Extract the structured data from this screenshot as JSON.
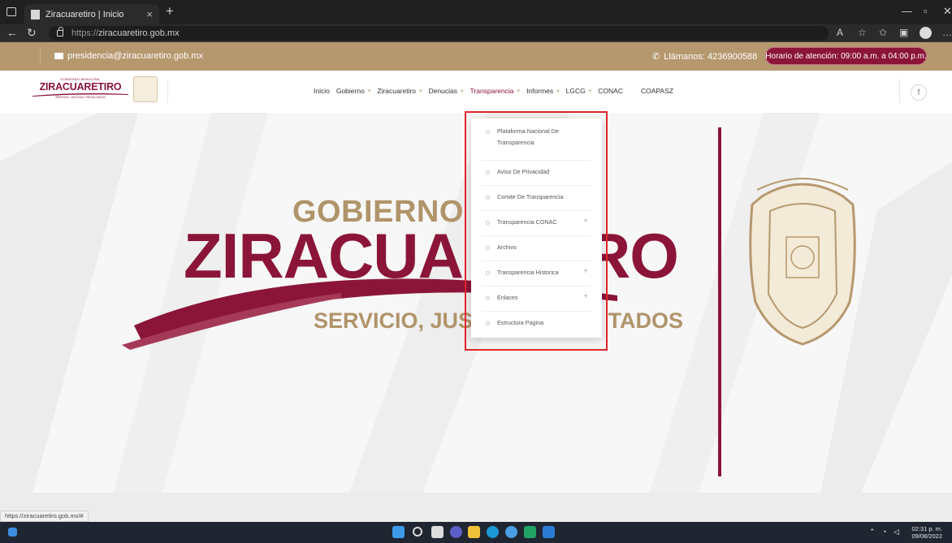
{
  "browser": {
    "tab_title": "Ziracuaretiro | Inicio",
    "tab_close": "×",
    "new_tab": "+",
    "url_protocol": "https://",
    "url_host": "ziracuaretiro.gob.mx",
    "status_url": "https://ziracuaretiro.gob.mx/#"
  },
  "topbar": {
    "email": "presidencia@ziracuaretiro.gob.mx",
    "phone": "Llámanos: 4236900588",
    "hours": "Horario de atención: 09:00 a.m. a 04:00 p.m."
  },
  "logo": {
    "small_text": "GOBIERNO MUNICIPAL",
    "name": "ZIRACUARETIRO",
    "tagline": "SERVICIO, JUSTICIA Y RESULTADOS"
  },
  "nav": {
    "items": [
      {
        "label": "Inicio",
        "has_chevron": false
      },
      {
        "label": "Gobierno",
        "has_chevron": true
      },
      {
        "label": "Ziracuaretiro",
        "has_chevron": true
      },
      {
        "label": "Denucias",
        "has_chevron": true
      },
      {
        "label": "Transparencia",
        "has_chevron": true,
        "active": true
      },
      {
        "label": "Informes",
        "has_chevron": true
      },
      {
        "label": "LGCG",
        "has_chevron": true
      },
      {
        "label": "CONAC",
        "has_chevron": false
      },
      {
        "label": "COAPASZ",
        "has_chevron": false
      }
    ],
    "facebook": "f"
  },
  "hero": {
    "line1": "GOBIERNO MU",
    "line2": "ZIRACUA",
    "line2_right": "RO",
    "line3": "SERVICIO, JUST",
    "line3_right": "TADOS"
  },
  "dropdown": {
    "items": [
      {
        "label": "Plataforma Nacional De Transparencia",
        "has_submenu": false
      },
      {
        "label": "Aviso De Privacidad",
        "has_submenu": false
      },
      {
        "label": "Comite De Transparencia",
        "has_submenu": false
      },
      {
        "label": "Transparencia CONAC",
        "has_submenu": true
      },
      {
        "label": "Archivo",
        "has_submenu": false
      },
      {
        "label": "Transparencia Historica",
        "has_submenu": true
      },
      {
        "label": "Enlaces",
        "has_submenu": true
      },
      {
        "label": "Estructura Pagina",
        "has_submenu": false
      }
    ]
  },
  "taskbar": {
    "time": "02:31 p. m.",
    "date": "09/08/2022"
  },
  "colors": {
    "brand": "#8b1538",
    "gold": "#b6986e",
    "highlight": "#e0262a"
  }
}
